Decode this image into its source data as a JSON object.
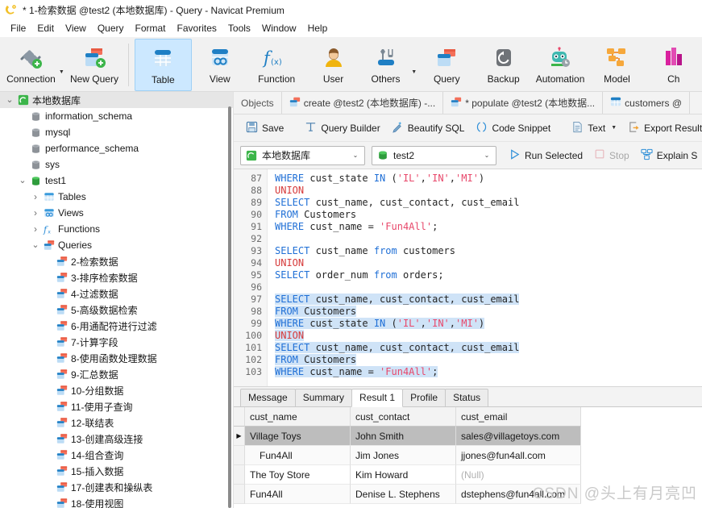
{
  "window": {
    "title": "* 1-检索数据 @test2 (本地数据库) - Query - Navicat Premium",
    "app_icon": "navicat-logo-icon"
  },
  "menubar": {
    "items": [
      {
        "label": "File"
      },
      {
        "label": "Edit"
      },
      {
        "label": "View"
      },
      {
        "label": "Query"
      },
      {
        "label": "Format"
      },
      {
        "label": "Favorites"
      },
      {
        "label": "Tools"
      },
      {
        "label": "Window"
      },
      {
        "label": "Help"
      }
    ]
  },
  "toolbar": {
    "buttons": [
      {
        "label": "Connection",
        "icon": "connection-icon",
        "has_caret": true,
        "selected": false
      },
      {
        "label": "New Query",
        "icon": "new-query-icon",
        "has_caret": false,
        "selected": false
      },
      {
        "label": "Table",
        "icon": "table-icon",
        "has_caret": false,
        "selected": true
      },
      {
        "label": "View",
        "icon": "view-icon",
        "has_caret": false,
        "selected": false
      },
      {
        "label": "Function",
        "icon": "function-icon",
        "has_caret": false,
        "selected": false
      },
      {
        "label": "User",
        "icon": "user-icon",
        "has_caret": false,
        "selected": false
      },
      {
        "label": "Others",
        "icon": "others-icon",
        "has_caret": true,
        "selected": false
      },
      {
        "label": "Query",
        "icon": "query-icon",
        "has_caret": false,
        "selected": false
      },
      {
        "label": "Backup",
        "icon": "backup-icon",
        "has_caret": false,
        "selected": false
      },
      {
        "label": "Automation",
        "icon": "automation-icon",
        "has_caret": false,
        "selected": false
      },
      {
        "label": "Model",
        "icon": "model-icon",
        "has_caret": false,
        "selected": false
      },
      {
        "label": "Ch",
        "icon": "chart-icon",
        "has_caret": false,
        "selected": false
      }
    ]
  },
  "sidebar": {
    "items": [
      {
        "label": "本地数据库",
        "icon": "navicat-connection-icon",
        "depth": 0,
        "twisty": "expanded",
        "selected": true
      },
      {
        "label": "information_schema",
        "icon": "database-gray-icon",
        "depth": 1,
        "twisty": "none",
        "selected": false
      },
      {
        "label": "mysql",
        "icon": "database-gray-icon",
        "depth": 1,
        "twisty": "none",
        "selected": false
      },
      {
        "label": "performance_schema",
        "icon": "database-gray-icon",
        "depth": 1,
        "twisty": "none",
        "selected": false
      },
      {
        "label": "sys",
        "icon": "database-gray-icon",
        "depth": 1,
        "twisty": "none",
        "selected": false
      },
      {
        "label": "test1",
        "icon": "database-green-icon",
        "depth": 1,
        "twisty": "expanded",
        "selected": false
      },
      {
        "label": "Tables",
        "icon": "tables-folder-icon",
        "depth": 2,
        "twisty": "collapsed",
        "selected": false
      },
      {
        "label": "Views",
        "icon": "views-folder-icon",
        "depth": 2,
        "twisty": "collapsed",
        "selected": false
      },
      {
        "label": "Functions",
        "icon": "functions-folder-icon",
        "depth": 2,
        "twisty": "collapsed",
        "selected": false
      },
      {
        "label": "Queries",
        "icon": "queries-folder-icon",
        "depth": 2,
        "twisty": "expanded",
        "selected": false
      },
      {
        "label": "2-检索数据",
        "icon": "query-file-icon",
        "depth": 3,
        "twisty": "none",
        "selected": false
      },
      {
        "label": "3-排序检索数据",
        "icon": "query-file-icon",
        "depth": 3,
        "twisty": "none",
        "selected": false
      },
      {
        "label": "4-过滤数据",
        "icon": "query-file-icon",
        "depth": 3,
        "twisty": "none",
        "selected": false
      },
      {
        "label": "5-高级数据检索",
        "icon": "query-file-icon",
        "depth": 3,
        "twisty": "none",
        "selected": false
      },
      {
        "label": "6-用通配符进行过滤",
        "icon": "query-file-icon",
        "depth": 3,
        "twisty": "none",
        "selected": false
      },
      {
        "label": "7-计算字段",
        "icon": "query-file-icon",
        "depth": 3,
        "twisty": "none",
        "selected": false
      },
      {
        "label": "8-使用函数处理数据",
        "icon": "query-file-icon",
        "depth": 3,
        "twisty": "none",
        "selected": false
      },
      {
        "label": "9-汇总数据",
        "icon": "query-file-icon",
        "depth": 3,
        "twisty": "none",
        "selected": false
      },
      {
        "label": "10-分组数据",
        "icon": "query-file-icon",
        "depth": 3,
        "twisty": "none",
        "selected": false
      },
      {
        "label": "11-使用子查询",
        "icon": "query-file-icon",
        "depth": 3,
        "twisty": "none",
        "selected": false
      },
      {
        "label": "12-联结表",
        "icon": "query-file-icon",
        "depth": 3,
        "twisty": "none",
        "selected": false
      },
      {
        "label": "13-创建高级连接",
        "icon": "query-file-icon",
        "depth": 3,
        "twisty": "none",
        "selected": false
      },
      {
        "label": "14-组合查询",
        "icon": "query-file-icon",
        "depth": 3,
        "twisty": "none",
        "selected": false
      },
      {
        "label": "15-插入数据",
        "icon": "query-file-icon",
        "depth": 3,
        "twisty": "none",
        "selected": false
      },
      {
        "label": "17-创建表和操纵表",
        "icon": "query-file-icon",
        "depth": 3,
        "twisty": "none",
        "selected": false
      },
      {
        "label": "18-使用视图",
        "icon": "query-file-icon",
        "depth": 3,
        "twisty": "none",
        "selected": false
      }
    ]
  },
  "doc_tabs": [
    {
      "label": "Objects",
      "icon": "none",
      "active": false
    },
    {
      "label": "create @test2 (本地数据库) -...",
      "icon": "query-file-icon",
      "active": false
    },
    {
      "label": "* populate @test2 (本地数据...",
      "icon": "query-file-icon",
      "active": false
    },
    {
      "label": "customers @",
      "icon": "table-icon",
      "active": false
    }
  ],
  "query_toolbar": {
    "buttons": [
      {
        "label": "Save",
        "icon": "save-icon",
        "caret": false,
        "disabled": false
      },
      {
        "label": "Query Builder",
        "icon": "query-builder-icon",
        "caret": false,
        "disabled": false
      },
      {
        "label": "Beautify SQL",
        "icon": "beautify-sql-icon",
        "caret": false,
        "disabled": false
      },
      {
        "label": "Code Snippet",
        "icon": "code-snippet-icon",
        "caret": false,
        "disabled": false
      },
      {
        "label": "Text",
        "icon": "text-icon",
        "caret": true,
        "disabled": false
      },
      {
        "label": "Export Result",
        "icon": "export-result-icon",
        "caret": false,
        "disabled": false
      }
    ]
  },
  "run_bar": {
    "connection_combo": {
      "value": "本地数据库",
      "icon": "navicat-connection-icon"
    },
    "database_combo": {
      "value": "test2",
      "icon": "database-green-icon"
    },
    "run_selected": {
      "label": "Run Selected",
      "icon": "play-icon",
      "disabled": false
    },
    "stop": {
      "label": "Stop",
      "icon": "stop-icon",
      "disabled": true
    },
    "explain": {
      "label": "Explain S",
      "icon": "explain-sql-icon",
      "disabled": false
    }
  },
  "editor": {
    "first_line": 87,
    "lines": [
      {
        "n": 87,
        "selected": false,
        "tokens": [
          {
            "t": "WHERE",
            "c": "kw"
          },
          {
            "t": " cust_state ",
            "c": "pln"
          },
          {
            "t": "IN",
            "c": "kw"
          },
          {
            "t": " (",
            "c": "pln"
          },
          {
            "t": "'IL'",
            "c": "str"
          },
          {
            "t": ",",
            "c": "pln"
          },
          {
            "t": "'IN'",
            "c": "str"
          },
          {
            "t": ",",
            "c": "pln"
          },
          {
            "t": "'MI'",
            "c": "str"
          },
          {
            "t": ")",
            "c": "pln"
          }
        ]
      },
      {
        "n": 88,
        "selected": false,
        "tokens": [
          {
            "t": "UNION",
            "c": "kwr"
          }
        ]
      },
      {
        "n": 89,
        "selected": false,
        "tokens": [
          {
            "t": "SELECT",
            "c": "kw"
          },
          {
            "t": " cust_name, cust_contact, cust_email",
            "c": "pln"
          }
        ]
      },
      {
        "n": 90,
        "selected": false,
        "tokens": [
          {
            "t": "FROM",
            "c": "kw"
          },
          {
            "t": " Customers",
            "c": "pln"
          }
        ]
      },
      {
        "n": 91,
        "selected": false,
        "tokens": [
          {
            "t": "WHERE",
            "c": "kw"
          },
          {
            "t": " cust_name = ",
            "c": "pln"
          },
          {
            "t": "'Fun4All'",
            "c": "str"
          },
          {
            "t": ";",
            "c": "pln"
          }
        ]
      },
      {
        "n": 92,
        "selected": false,
        "tokens": []
      },
      {
        "n": 93,
        "selected": false,
        "tokens": [
          {
            "t": "SELECT",
            "c": "kw"
          },
          {
            "t": " cust_name ",
            "c": "pln"
          },
          {
            "t": "from",
            "c": "kw"
          },
          {
            "t": " customers",
            "c": "pln"
          }
        ]
      },
      {
        "n": 94,
        "selected": false,
        "tokens": [
          {
            "t": "UNION",
            "c": "kwr"
          }
        ]
      },
      {
        "n": 95,
        "selected": false,
        "tokens": [
          {
            "t": "SELECT",
            "c": "kw"
          },
          {
            "t": " order_num ",
            "c": "pln"
          },
          {
            "t": "from",
            "c": "kw"
          },
          {
            "t": " orders;",
            "c": "pln"
          }
        ]
      },
      {
        "n": 96,
        "selected": false,
        "tokens": []
      },
      {
        "n": 97,
        "selected": true,
        "tokens": [
          {
            "t": "SELECT",
            "c": "kw"
          },
          {
            "t": " cust_name, cust_contact, cust_email",
            "c": "pln"
          }
        ]
      },
      {
        "n": 98,
        "selected": true,
        "tokens": [
          {
            "t": "FROM",
            "c": "kw"
          },
          {
            "t": " Customers",
            "c": "pln"
          }
        ]
      },
      {
        "n": 99,
        "selected": true,
        "tokens": [
          {
            "t": "WHERE",
            "c": "kw"
          },
          {
            "t": " cust_state ",
            "c": "pln"
          },
          {
            "t": "IN",
            "c": "kw"
          },
          {
            "t": " (",
            "c": "pln"
          },
          {
            "t": "'IL'",
            "c": "str"
          },
          {
            "t": ",",
            "c": "pln"
          },
          {
            "t": "'IN'",
            "c": "str"
          },
          {
            "t": ",",
            "c": "pln"
          },
          {
            "t": "'MI'",
            "c": "str"
          },
          {
            "t": ")",
            "c": "pln"
          }
        ]
      },
      {
        "n": 100,
        "selected": true,
        "tokens": [
          {
            "t": "UNION",
            "c": "kwr"
          }
        ]
      },
      {
        "n": 101,
        "selected": true,
        "tokens": [
          {
            "t": "SELECT",
            "c": "kw"
          },
          {
            "t": " cust_name, cust_contact, cust_email",
            "c": "pln"
          }
        ]
      },
      {
        "n": 102,
        "selected": true,
        "tokens": [
          {
            "t": "FROM",
            "c": "kw"
          },
          {
            "t": " Customers",
            "c": "pln"
          }
        ]
      },
      {
        "n": 103,
        "selected": true,
        "tokens": [
          {
            "t": "WHERE",
            "c": "kw"
          },
          {
            "t": " cust_name = ",
            "c": "pln"
          },
          {
            "t": "'Fun4All'",
            "c": "str"
          },
          {
            "t": ";",
            "c": "pln"
          }
        ]
      }
    ]
  },
  "result_tabs": [
    {
      "label": "Message",
      "active": false
    },
    {
      "label": "Summary",
      "active": false
    },
    {
      "label": "Result 1",
      "active": true
    },
    {
      "label": "Profile",
      "active": false
    },
    {
      "label": "Status",
      "active": false
    }
  ],
  "result_grid": {
    "columns": [
      "cust_name",
      "cust_contact",
      "cust_email"
    ],
    "rows": [
      {
        "cells": [
          "Village Toys",
          "John Smith",
          "sales@villagetoys.com"
        ],
        "selected": true,
        "indent": false,
        "null_cols": []
      },
      {
        "cells": [
          "Fun4All",
          "Jim Jones",
          "jjones@fun4all.com"
        ],
        "selected": false,
        "indent": true,
        "null_cols": []
      },
      {
        "cells": [
          "The Toy Store",
          "Kim Howard",
          "(Null)"
        ],
        "selected": false,
        "indent": false,
        "null_cols": [
          2
        ]
      },
      {
        "cells": [
          "Fun4All",
          "Denise L. Stephens",
          "dstephens@fun4all.com"
        ],
        "selected": false,
        "indent": false,
        "null_cols": []
      }
    ]
  },
  "watermark": {
    "text": "CSDN @头上有月亮凹"
  },
  "colors": {
    "accent_blue": "#1f6fd6",
    "keyword_red": "#d63a3a",
    "string_pink": "#e8486b",
    "selection": "#cfe3f7",
    "toolbar_bg": "#f1f1f1",
    "tree_selected": "#e6e6e6",
    "grid_selected": "#bdbdbd"
  }
}
